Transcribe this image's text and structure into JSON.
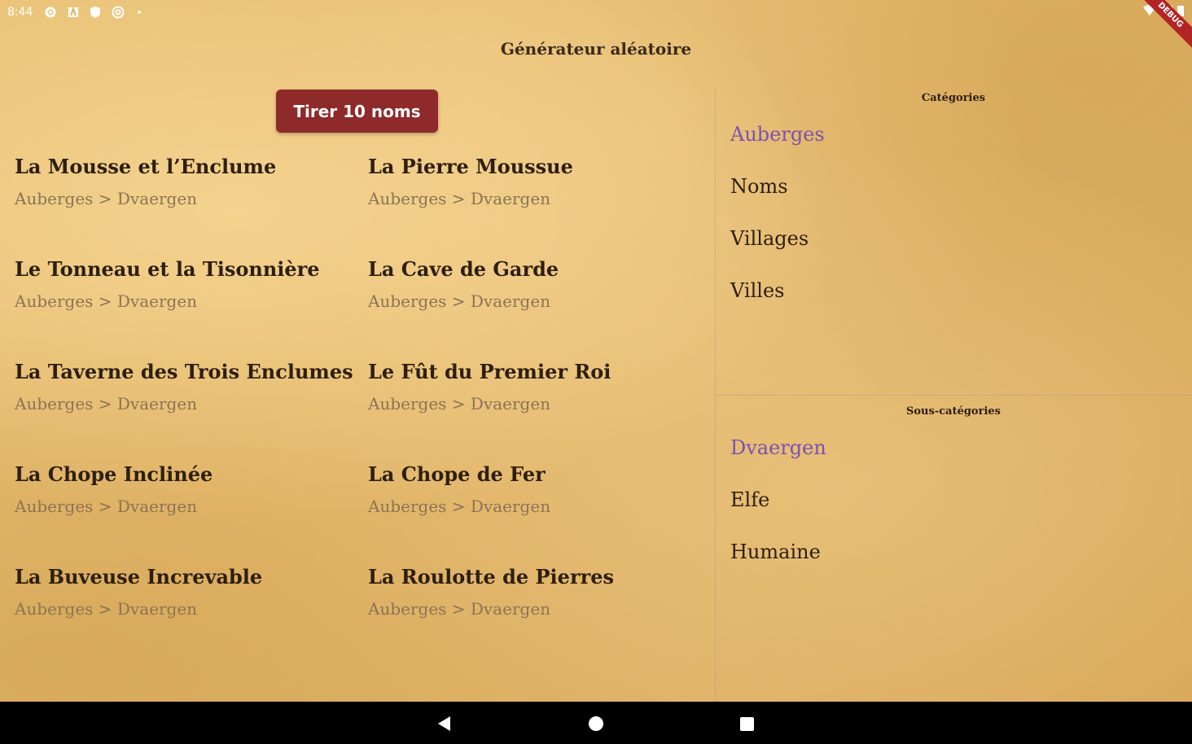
{
  "status_bar": {
    "time": "8:44",
    "icons": [
      "gear-icon",
      "a-icon",
      "shield-icon",
      "at-icon",
      "dot-icon"
    ],
    "right_icons": [
      "wifi-icon",
      "signal-icon",
      "battery-icon"
    ],
    "debug_label": "DEBUG"
  },
  "app": {
    "title": "Générateur aléatoire"
  },
  "draw_button": {
    "label": "Tirer 10 noms",
    "color": "#8e2a2a"
  },
  "results": [
    {
      "name": "La Mousse et l’Enclume",
      "path": "Auberges > Dvaergen"
    },
    {
      "name": "La Pierre Moussue",
      "path": "Auberges > Dvaergen"
    },
    {
      "name": "Le Tonneau et la Tisonnière",
      "path": "Auberges > Dvaergen"
    },
    {
      "name": "La Cave de Garde",
      "path": "Auberges > Dvaergen"
    },
    {
      "name": "La Taverne des Trois Enclumes",
      "path": "Auberges > Dvaergen"
    },
    {
      "name": "Le Fût du Premier Roi",
      "path": "Auberges > Dvaergen"
    },
    {
      "name": "La Chope Inclinée",
      "path": "Auberges > Dvaergen"
    },
    {
      "name": "La Chope de Fer",
      "path": "Auberges > Dvaergen"
    },
    {
      "name": "La Buveuse Increvable",
      "path": "Auberges > Dvaergen"
    },
    {
      "name": "La Roulotte de Pierres",
      "path": "Auberges > Dvaergen"
    }
  ],
  "categories": {
    "title": "Catégories",
    "items": [
      "Auberges",
      "Noms",
      "Villages",
      "Villes"
    ],
    "selected": "Auberges"
  },
  "subcategories": {
    "title": "Sous-catégories",
    "items": [
      "Dvaergen",
      "Elfe",
      "Humaine"
    ],
    "selected": "Dvaergen"
  },
  "colors": {
    "selected_item": "#7b52b0",
    "text": "#2d1f10",
    "path_text": "#8b7355"
  },
  "nav_bar": {
    "icons": [
      "back-icon",
      "home-icon",
      "recents-icon"
    ]
  }
}
